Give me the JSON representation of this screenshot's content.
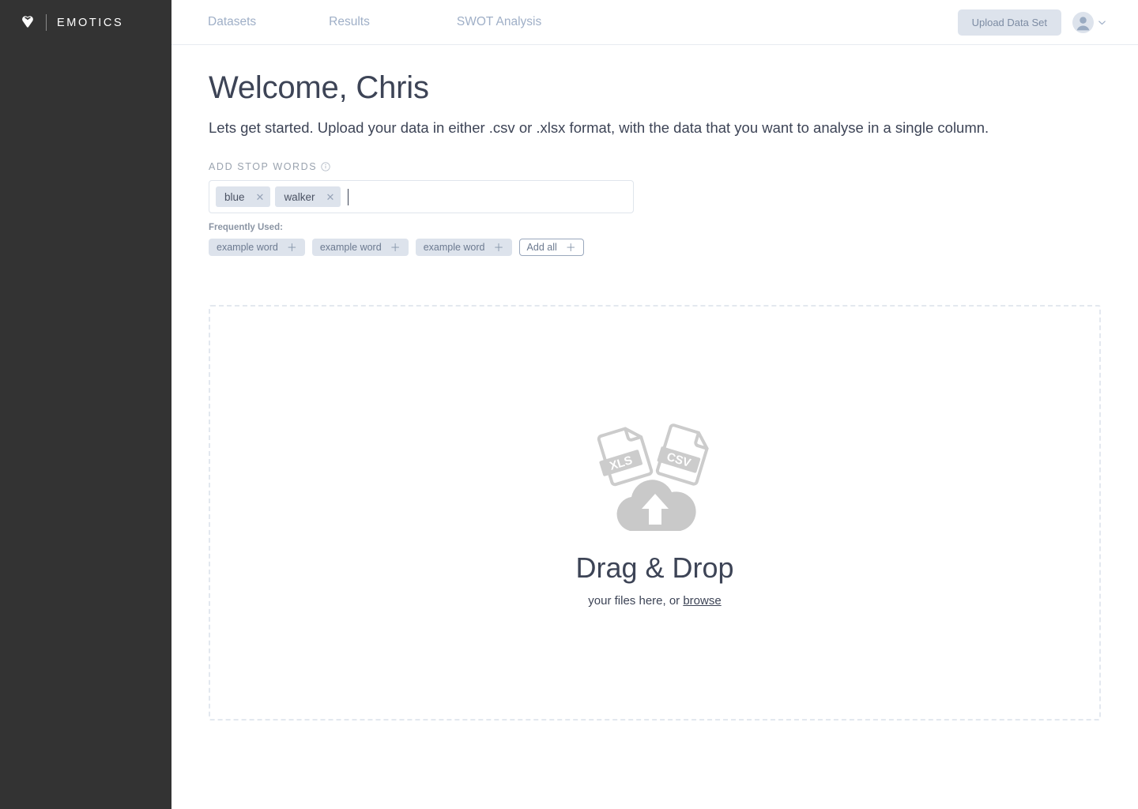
{
  "brand": {
    "name": "EMOTICS",
    "logo_icon": "heart-icon"
  },
  "header": {
    "nav": [
      {
        "label": "Datasets"
      },
      {
        "label": "Results"
      },
      {
        "label": "SWOT Analysis"
      }
    ],
    "upload_button": "Upload Data Set",
    "avatar_icon": "user-avatar-icon",
    "chevron_icon": "chevron-down-icon"
  },
  "main": {
    "title": "Welcome, Chris",
    "subtitle": "Lets get started. Upload your data in either .csv or .xlsx format, with the data that you want to analyse in a single column.",
    "stop_words": {
      "label": "ADD STOP WORDS",
      "info_icon": "info-icon",
      "input_placeholder": "",
      "input_value": "",
      "tags": [
        {
          "label": "blue",
          "remove_icon": "close-icon",
          "remove_glyph": "✕"
        },
        {
          "label": "walker",
          "remove_icon": "close-icon",
          "remove_glyph": "✕"
        }
      ],
      "frequently_used_label": "Frequently Used:",
      "frequent_chips": [
        {
          "label": "example word",
          "action_glyph": "＋"
        },
        {
          "label": "example word",
          "action_glyph": "＋"
        },
        {
          "label": "example word",
          "action_glyph": "＋"
        }
      ],
      "add_all_chip": {
        "label": "Add all",
        "action_glyph": "＋"
      }
    },
    "dropzone": {
      "art_icon": "file-upload-cloud-icon",
      "file_labels": [
        "XLS",
        "CSV"
      ],
      "title": "Drag & Drop",
      "subtitle_prefix": "your files here, or ",
      "browse_link": "browse"
    }
  },
  "colors": {
    "sidebar": "#333333",
    "nav_text": "#9fafc7",
    "heading": "#3d4456",
    "chip_bg": "#dde3ec",
    "dropzone_border": "#e3e8ef",
    "art_gray": "#c9c9c9"
  }
}
